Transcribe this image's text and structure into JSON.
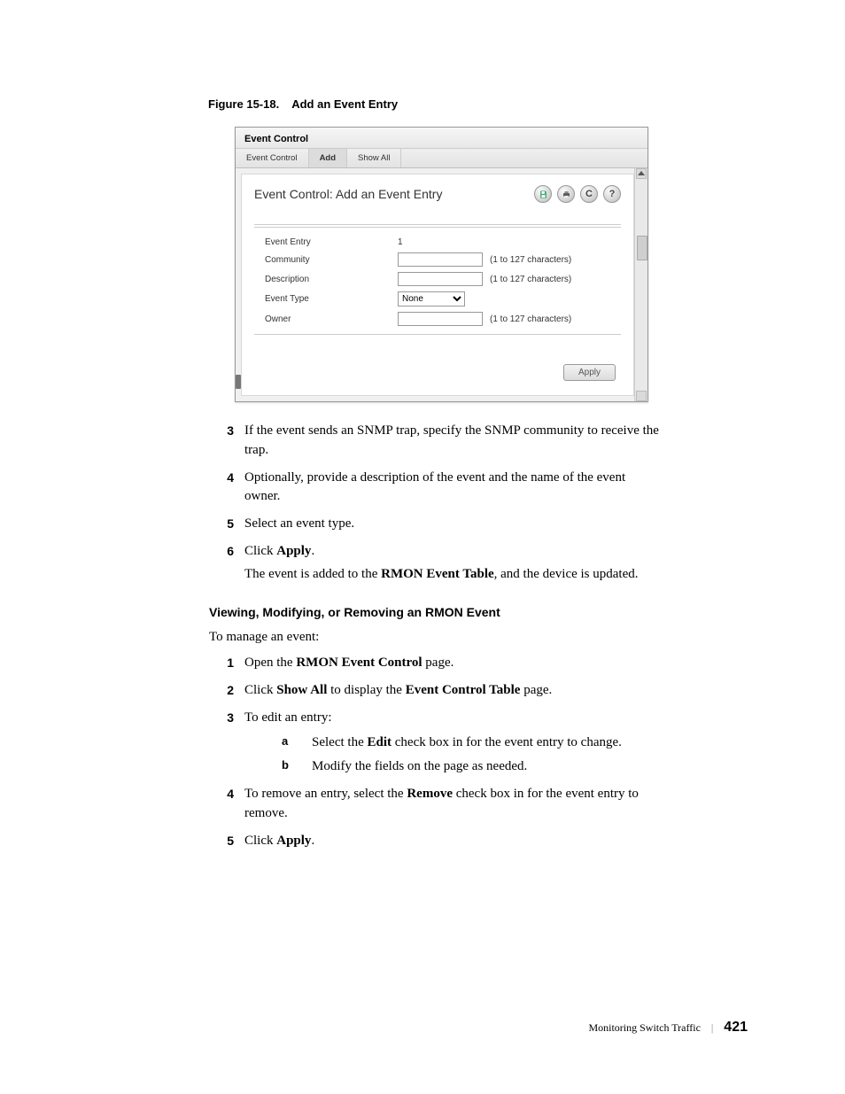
{
  "figure": {
    "num": "Figure 15-18.",
    "title": "Add an Event Entry"
  },
  "shot": {
    "winTitle": "Event Control",
    "tabs": [
      "Event Control",
      "Add",
      "Show All"
    ],
    "activeTab": 1,
    "paneTitle": "Event Control: Add an Event Entry",
    "icons": [
      "save-icon",
      "print-icon",
      "refresh-icon",
      "help-icon"
    ],
    "rows": {
      "eventEntry": {
        "label": "Event Entry",
        "value": "1"
      },
      "community": {
        "label": "Community",
        "hint": "(1 to 127 characters)"
      },
      "description": {
        "label": "Description",
        "hint": "(1 to 127 characters)"
      },
      "eventType": {
        "label": "Event Type",
        "value": "None"
      },
      "owner": {
        "label": "Owner",
        "hint": "(1 to 127 characters)"
      }
    },
    "apply": "Apply"
  },
  "stepsA": {
    "s3": "If the event sends an SNMP trap, specify the SNMP community to receive the trap.",
    "s4": "Optionally, provide a description of the event and the name of the event owner.",
    "s5": "Select an event type.",
    "s6_a": "Click ",
    "s6_b": "Apply",
    "s6_c": ".",
    "s6_cont_a": "The event is added to the ",
    "s6_cont_b": "RMON Event Table",
    "s6_cont_c": ", and the device is updated."
  },
  "h2": "Viewing, Modifying, or Removing an RMON Event",
  "lead": "To manage an event:",
  "stepsB": {
    "s1_a": "Open the ",
    "s1_b": "RMON Event Control",
    "s1_c": " page.",
    "s2_a": "Click ",
    "s2_b": "Show All",
    "s2_c": " to display the ",
    "s2_d": "Event Control Table",
    "s2_e": " page.",
    "s3": "To edit an entry:",
    "s3a_a": "Select the ",
    "s3a_b": "Edit",
    "s3a_c": " check box in for the event entry to change.",
    "s3b": "Modify the fields on the page as needed.",
    "s4_a": "To remove an entry, select the ",
    "s4_b": "Remove",
    "s4_c": " check box in for the event entry to remove.",
    "s5_a": "Click ",
    "s5_b": "Apply",
    "s5_c": "."
  },
  "footer": {
    "section": "Monitoring Switch Traffic",
    "page": "421"
  }
}
